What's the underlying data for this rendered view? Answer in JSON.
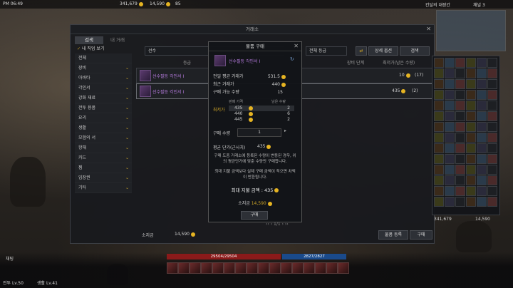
{
  "hud": {
    "time": "PM 06:49",
    "currency1": "341,679",
    "currency2": "14,590",
    "currency3": "85",
    "location": "칸달의 대장간",
    "channel": "채널 3"
  },
  "market": {
    "title": "거래소",
    "tabs": [
      "검색",
      "내 거래"
    ],
    "favorites_label": "내 직업 보기",
    "categories": [
      "전체",
      "장비",
      "아바타",
      "각인서",
      "강화 재료",
      "전투 용품",
      "요리",
      "생활",
      "모험의 서",
      "항해",
      "카드",
      "젬",
      "입장권",
      "기타"
    ],
    "search_placeholder": "선수",
    "grade_label": "전체 등급",
    "detail_button": "상세 옵션",
    "search_button": "검색",
    "col_grade": "등급",
    "col_level": "장비 단계",
    "col_price": "최저가(남은 수량)",
    "rows": [
      {
        "name": "선수필등 각인서 I",
        "price": "10",
        "qty": "(17)"
      },
      {
        "name": "선수필등 각인서 I",
        "price": "435",
        "qty": "(2)"
      }
    ],
    "pagination": "1/1",
    "gold_label": "소지금",
    "gold_value": "14,590",
    "register_button": "물품 등록",
    "buy_button": "구매"
  },
  "modal": {
    "title": "물품 구매",
    "item_name": "선수필등 각인서 I",
    "stats": [
      {
        "label": "전일 평균 거래가",
        "value": "531.5"
      },
      {
        "label": "최근 거래가",
        "value": "440"
      },
      {
        "label": "구매 가능 수량",
        "value": "15"
      }
    ],
    "lowest_label": "최저가",
    "header_price": "판매 가격",
    "header_qty": "남은 수량",
    "listings": [
      {
        "price": "435",
        "qty": "2"
      },
      {
        "price": "440",
        "qty": "6"
      },
      {
        "price": "445",
        "qty": "2"
      }
    ],
    "qty_label": "구매 수량",
    "qty_value": "1",
    "avg_label": "평균 단가(근사치)",
    "avg_value": "435",
    "notice1": "구매 도중 거래소에 등록된 수량이 변동된 경우, 위의 평균단가에 맞춘 수량만 구매합니다.",
    "notice2": "최대 지불 금액보다 실제 구매 금액이 적으면 차액이 반환됩니다.",
    "max_pay": "최대 지불 금액 : 435",
    "gold_label": "소지금",
    "gold_value": "14,590",
    "buy_button": "구매"
  },
  "bottom": {
    "hp": "29504/29504",
    "mp": "2827/2827",
    "level1": "전투 Lv.50",
    "level2": "생활 Lv.41",
    "chat": "채팅"
  },
  "inventory": {
    "gold": "341,679",
    "silver": "14,590",
    "counts": [
      "5",
      "11",
      "53",
      "12",
      "26"
    ]
  }
}
